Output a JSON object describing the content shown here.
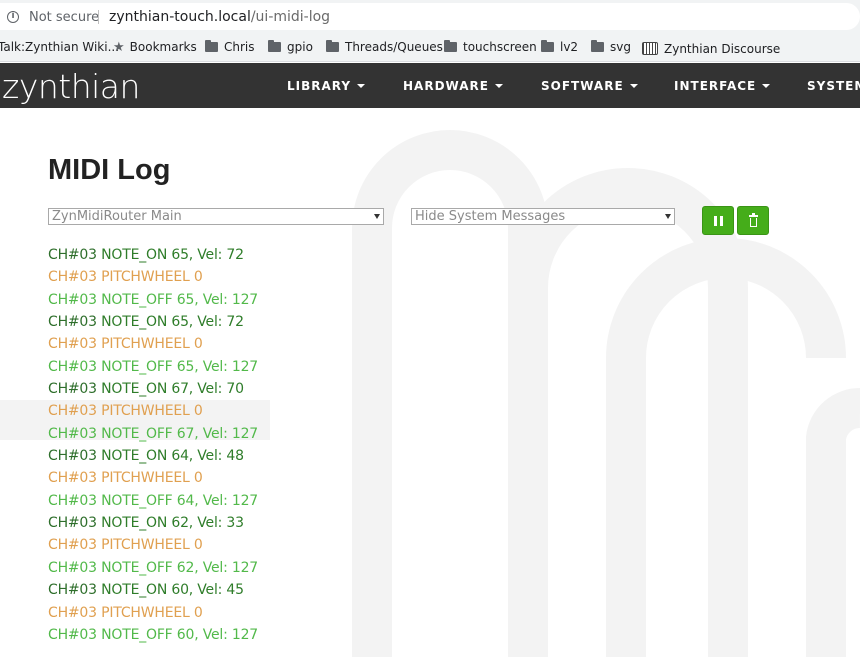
{
  "browser": {
    "security_label": "Not secure",
    "url_host": "zynthian-touch.local",
    "url_path": "/ui-midi-log",
    "bookmarks": [
      {
        "label": "Talk:Zynthian Wiki...",
        "icon": "page-icon"
      },
      {
        "label": "Bookmarks",
        "icon": "star-icon"
      },
      {
        "label": "Chris",
        "icon": "folder-icon"
      },
      {
        "label": "gpio",
        "icon": "folder-icon"
      },
      {
        "label": "Threads/Queues",
        "icon": "folder-icon"
      },
      {
        "label": "touchscreen",
        "icon": "folder-icon"
      },
      {
        "label": "lv2",
        "icon": "folder-icon"
      },
      {
        "label": "svg",
        "icon": "folder-icon"
      },
      {
        "label": "Zynthian Discourse",
        "icon": "discourse-icon"
      }
    ]
  },
  "navbar": {
    "logo": "zynthian",
    "items": [
      {
        "label": "LIBRARY"
      },
      {
        "label": "HARDWARE"
      },
      {
        "label": "SOFTWARE"
      },
      {
        "label": "INTERFACE"
      },
      {
        "label": "SYSTEM"
      }
    ],
    "background": "#333333"
  },
  "page": {
    "title": "MIDI Log",
    "port_select": {
      "value": "ZynMidiRouter Main"
    },
    "filter_select": {
      "value": "Hide System Messages"
    },
    "pause_button": {
      "icon": "pause-icon",
      "color": "#45ad1a"
    },
    "clear_button": {
      "icon": "trash-icon",
      "color": "#45ad1a"
    }
  },
  "colors": {
    "note_on": "#2f7d2a",
    "note_off": "#52b94a",
    "pitchwheel": "#e0a050"
  },
  "log": [
    {
      "channel": "CH#03",
      "message": "NOTE_ON 65, Vel: 72",
      "type": "note_on"
    },
    {
      "channel": "CH#03",
      "message": "PITCHWHEEL 0",
      "type": "pitchwheel"
    },
    {
      "channel": "CH#03",
      "message": "NOTE_OFF 65, Vel: 127",
      "type": "note_off"
    },
    {
      "channel": "CH#03",
      "message": "NOTE_ON 65, Vel: 72",
      "type": "note_on"
    },
    {
      "channel": "CH#03",
      "message": "PITCHWHEEL 0",
      "type": "pitchwheel"
    },
    {
      "channel": "CH#03",
      "message": "NOTE_OFF 65, Vel: 127",
      "type": "note_off"
    },
    {
      "channel": "CH#03",
      "message": "NOTE_ON 67, Vel: 70",
      "type": "note_on"
    },
    {
      "channel": "CH#03",
      "message": "PITCHWHEEL 0",
      "type": "pitchwheel"
    },
    {
      "channel": "CH#03",
      "message": "NOTE_OFF 67, Vel: 127",
      "type": "note_off"
    },
    {
      "channel": "CH#03",
      "message": "NOTE_ON 64, Vel: 48",
      "type": "note_on"
    },
    {
      "channel": "CH#03",
      "message": "PITCHWHEEL 0",
      "type": "pitchwheel"
    },
    {
      "channel": "CH#03",
      "message": "NOTE_OFF 64, Vel: 127",
      "type": "note_off"
    },
    {
      "channel": "CH#03",
      "message": "NOTE_ON 62, Vel: 33",
      "type": "note_on"
    },
    {
      "channel": "CH#03",
      "message": "PITCHWHEEL 0",
      "type": "pitchwheel"
    },
    {
      "channel": "CH#03",
      "message": "NOTE_OFF 62, Vel: 127",
      "type": "note_off"
    },
    {
      "channel": "CH#03",
      "message": "NOTE_ON 60, Vel: 45",
      "type": "note_on"
    },
    {
      "channel": "CH#03",
      "message": "PITCHWHEEL 0",
      "type": "pitchwheel"
    },
    {
      "channel": "CH#03",
      "message": "NOTE_OFF 60, Vel: 127",
      "type": "note_off"
    }
  ]
}
